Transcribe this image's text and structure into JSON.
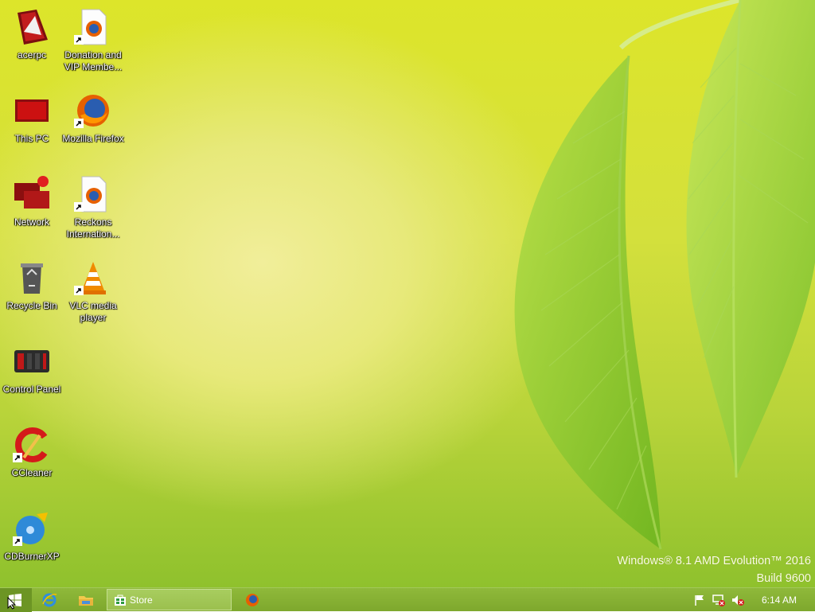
{
  "desktop": {
    "icons": [
      {
        "label": "acerpc",
        "icon": "user-folder-icon"
      },
      {
        "label": "Donation and VIP Membe...",
        "icon": "firefox-document-icon"
      },
      {
        "label": "This PC",
        "icon": "computer-icon"
      },
      {
        "label": "Mozilla Firefox",
        "icon": "firefox-icon"
      },
      {
        "label": "Network",
        "icon": "network-icon"
      },
      {
        "label": "Reckons Internation...",
        "icon": "firefox-document-icon"
      },
      {
        "label": "Recycle Bin",
        "icon": "recycle-bin-icon"
      },
      {
        "label": "VLC media player",
        "icon": "vlc-icon"
      },
      {
        "label": "Control Panel",
        "icon": "control-panel-icon"
      },
      {
        "label": "CCleaner",
        "icon": "ccleaner-icon"
      },
      {
        "label": "CDBurnerXP",
        "icon": "cdburnerxp-icon"
      }
    ],
    "watermark": {
      "line1": "Windows® 8.1 AMD Evolution™ 2016",
      "line2": "Build 9600"
    }
  },
  "taskbar": {
    "pinned": [
      {
        "name": "start-button",
        "icon": "windows-logo-icon"
      },
      {
        "name": "internet-explorer",
        "icon": "internet-explorer-icon"
      },
      {
        "name": "file-explorer",
        "icon": "folder-icon"
      },
      {
        "name": "firefox",
        "icon": "firefox-icon"
      }
    ],
    "active_task": {
      "label": "Store",
      "icon": "store-icon"
    },
    "tray": {
      "icons": [
        "flag-icon",
        "network-disconnected-icon",
        "volume-muted-icon"
      ],
      "clock": "6:14 AM"
    }
  },
  "colors": {
    "taskbar": "#7ea82d",
    "desktop_base": "#d4e03c",
    "leaf": "#8fcf2a"
  }
}
